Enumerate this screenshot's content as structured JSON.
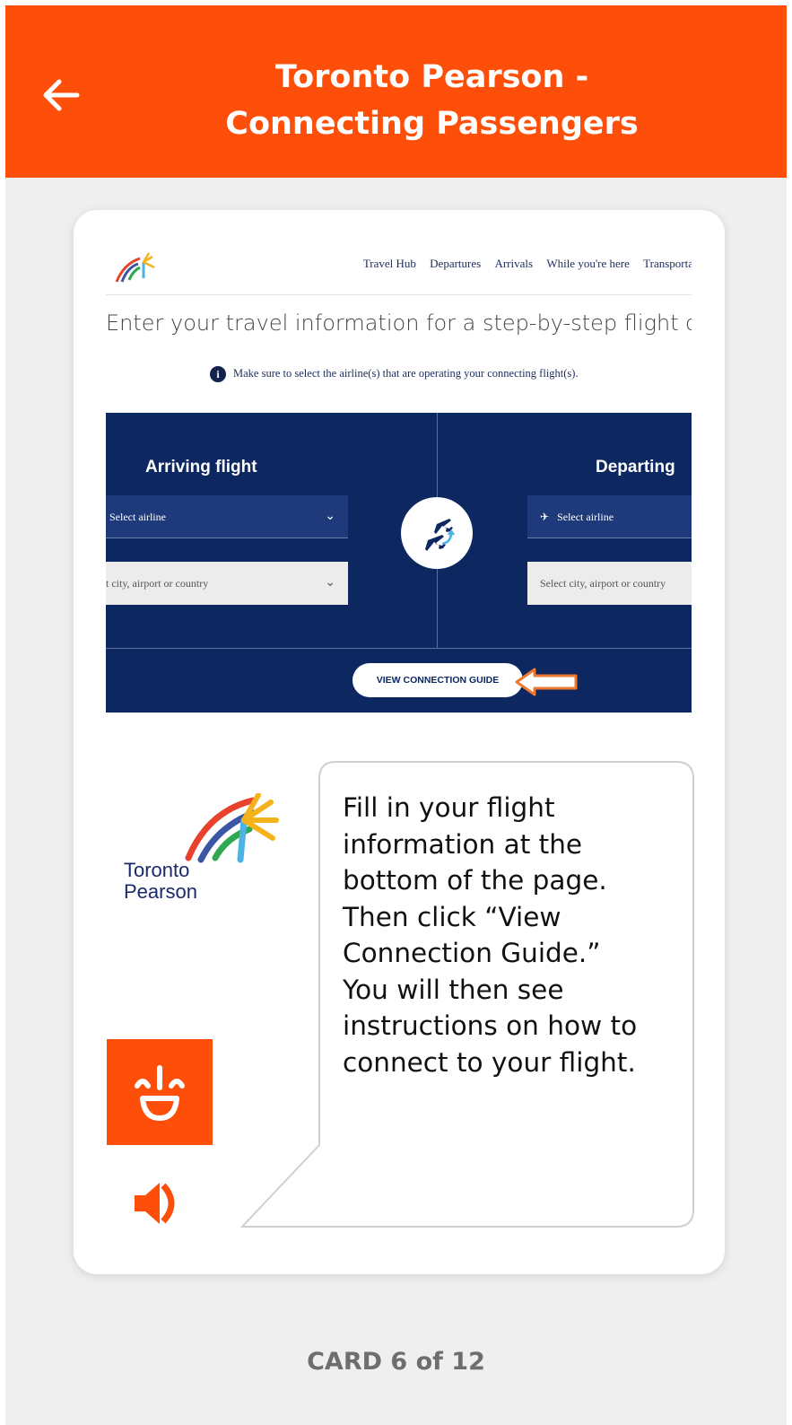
{
  "header": {
    "title_line1": "Toronto Pearson -",
    "title_line2": "Connecting Passengers",
    "back_icon": "arrow-left-icon",
    "background": "#fe4f0a"
  },
  "screenshot": {
    "nav": [
      "Travel Hub",
      "Departures",
      "Arrivals",
      "While you're here",
      "Transporta"
    ],
    "heading": "Enter your travel information for a step-by-step flight connectic",
    "note": "Make sure to select the airline(s) that are operating your connecting flight(s).",
    "arriving": {
      "title": "Arriving flight",
      "airline_placeholder": "Select airline",
      "city_placeholder": "t city, airport or country"
    },
    "departing": {
      "title": "Departing",
      "airline_placeholder": "Select airline",
      "city_placeholder": "Select city, airport or country"
    },
    "guide_button": "VIEW CONNECTION GUIDE",
    "panel_color": "#0d2761"
  },
  "brand": {
    "line1": "Toronto",
    "line2": "Pearson"
  },
  "bubble": {
    "lines": [
      "Fill in your flight",
      "information at the",
      "bottom of the page.",
      "Then click “View",
      "Connection Guide.”",
      "You will then see",
      "instructions on how to",
      "connect to your flight."
    ]
  },
  "controls": {
    "face_icon": "smiling-face-icon",
    "speaker_icon": "speaker-icon"
  },
  "footer": {
    "card_counter": "CARD 6 of 12"
  }
}
